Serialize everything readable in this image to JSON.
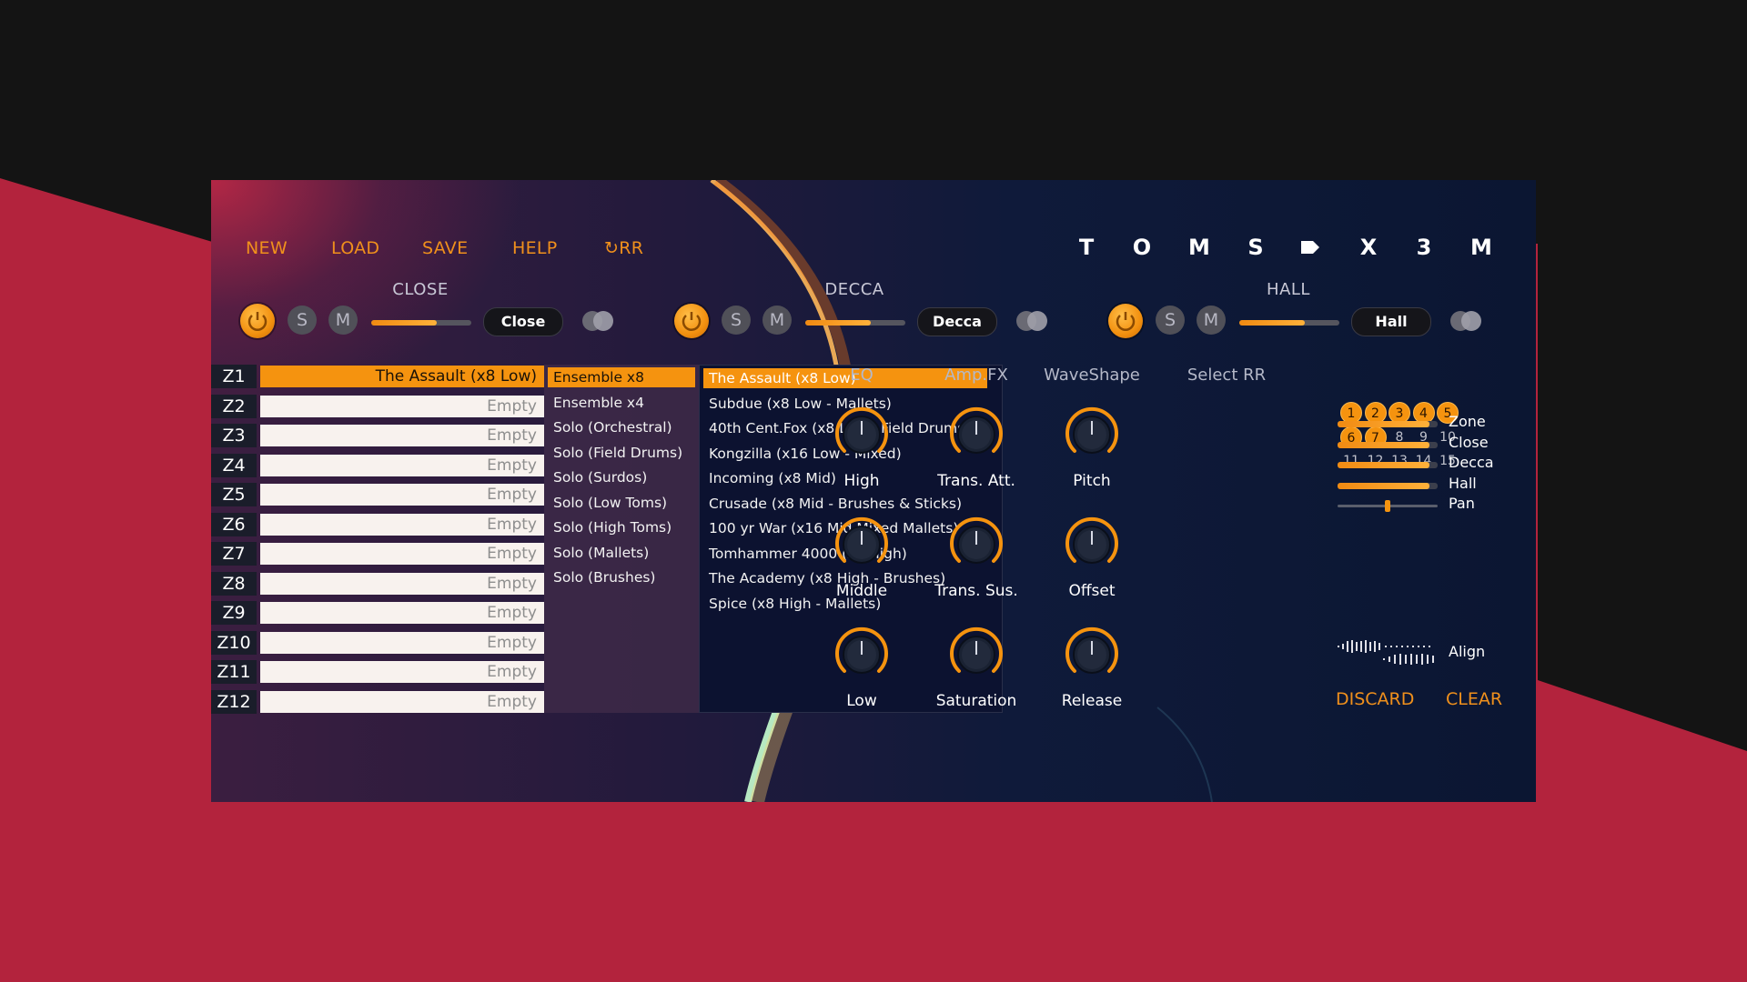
{
  "colors": {
    "accent": "#f5930f",
    "background_red": "#b3233d",
    "panel_dark": "#0b1632"
  },
  "menu": {
    "new": "NEW",
    "load": "LOAD",
    "save": "SAVE",
    "help": "HELP",
    "crr": "↻RR"
  },
  "logo": [
    "T",
    "O",
    "M",
    "S",
    "",
    "X",
    "3",
    "M"
  ],
  "mics": [
    {
      "label": "CLOSE",
      "solo": "S",
      "mute": "M",
      "preset": "Close",
      "level": 0.65
    },
    {
      "label": "DECCA",
      "solo": "S",
      "mute": "M",
      "preset": "Decca",
      "level": 0.65
    },
    {
      "label": "HALL",
      "solo": "S",
      "mute": "M",
      "preset": "Hall",
      "level": 0.65
    }
  ],
  "zones": [
    {
      "id": "Z1",
      "value": "The Assault (x8 Low)"
    },
    {
      "id": "Z2",
      "value": "Empty"
    },
    {
      "id": "Z3",
      "value": "Empty"
    },
    {
      "id": "Z4",
      "value": "Empty"
    },
    {
      "id": "Z5",
      "value": "Empty"
    },
    {
      "id": "Z6",
      "value": "Empty"
    },
    {
      "id": "Z7",
      "value": "Empty"
    },
    {
      "id": "Z8",
      "value": "Empty"
    },
    {
      "id": "Z9",
      "value": "Empty"
    },
    {
      "id": "Z10",
      "value": "Empty"
    },
    {
      "id": "Z11",
      "value": "Empty"
    },
    {
      "id": "Z12",
      "value": "Empty"
    }
  ],
  "categories": [
    "Ensemble x8",
    "Ensemble x4",
    "Solo (Orchestral)",
    "Solo (Field Drums)",
    "Solo (Surdos)",
    "Solo (Low Toms)",
    "Solo (High Toms)",
    "Solo (Mallets)",
    "Solo (Brushes)"
  ],
  "instruments": [
    "The Assault (x8 Low)",
    "Subdue (x8 Low - Mallets)",
    "40th Cent.Fox (x8 Low - Field Drums)",
    "Kongzilla (x16 Low - Mixed)",
    "Incoming (x8 Mid)",
    "Crusade (x8 Mid - Brushes & Sticks)",
    "100 yr War (x16 Mid Mixed Mallets)",
    "Tomhammer 4000 (x8 High)",
    "The Academy (x8 High - Brushes)",
    "Spice (x8 High - Mallets)"
  ],
  "columns": {
    "eq": "EQ",
    "ampfx": "Amp.FX",
    "waveshape": "WaveShape",
    "select_rr": "Select RR"
  },
  "knobs": {
    "high": "High",
    "middle": "Middle",
    "low": "Low",
    "trans_att": "Trans. Att.",
    "trans_sus": "Trans. Sus.",
    "saturation": "Saturation",
    "pitch": "Pitch",
    "offset": "Offset",
    "release": "Release"
  },
  "rr": {
    "numbers": [
      "1",
      "2",
      "3",
      "4",
      "5",
      "6",
      "7",
      "8",
      "9",
      "10",
      "11",
      "12",
      "13",
      "14",
      "15"
    ],
    "active_count": 7
  },
  "mixer": [
    {
      "label": "Zone",
      "level": 0.92
    },
    {
      "label": "Close",
      "level": 0.92
    },
    {
      "label": "Decca",
      "level": 0.92
    },
    {
      "label": "Hall",
      "level": 0.92
    },
    {
      "label": "Pan",
      "level": 0.5
    }
  ],
  "align_label": "Align",
  "actions": {
    "discard": "DISCARD",
    "clear": "CLEAR"
  }
}
